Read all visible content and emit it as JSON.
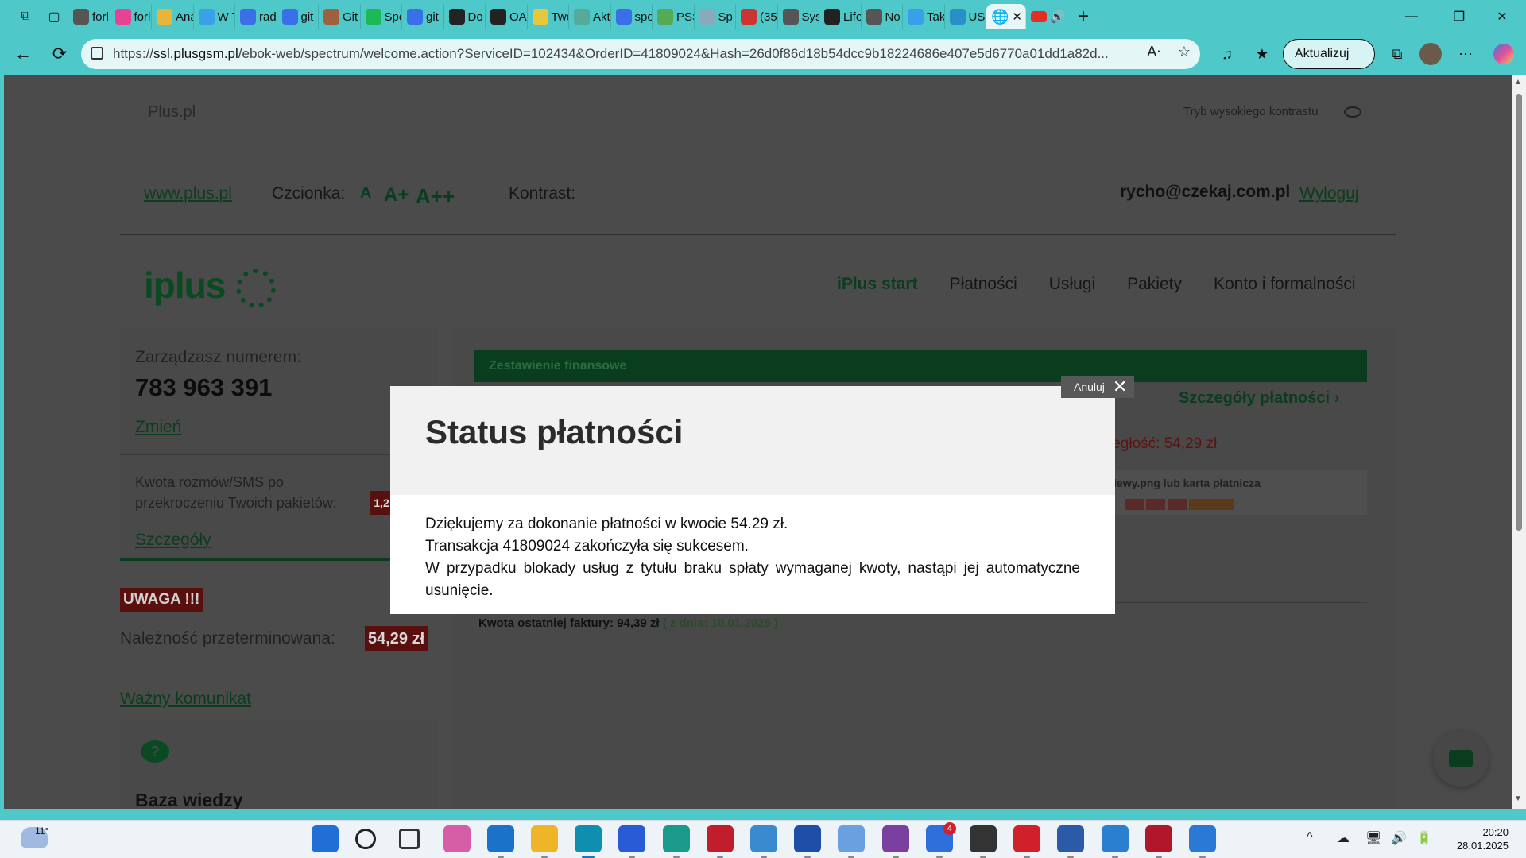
{
  "browser": {
    "tabs": [
      "forl",
      "forl",
      "Ana",
      "W T",
      "rad",
      "git",
      "Git",
      "Spo",
      "git",
      "Do",
      "OA",
      "Two",
      "Akt",
      "spo",
      "PSS",
      "Sp",
      "(35",
      "Sys",
      "Life",
      "No",
      "Tak",
      "US"
    ],
    "url_host": "ssl.plusgsm.pl",
    "url_path": "/ebok-web/spectrum/welcome.action?ServiceID=102434&OrderID=41809024&Hash=26d0f86d18b54dcc9b18224686e407e5d6770a01dd1a82d...",
    "url_scheme": "https://",
    "update_label": "Aktualizuj"
  },
  "page": {
    "header_logo": "Plus.pl",
    "high_contrast": "Tryb wysokiego kontrastu",
    "www_link": "www.plus.pl",
    "font_label": "Czcionka:",
    "font_sizes": [
      "A",
      "A+",
      "A++"
    ],
    "contrast_label": "Kontrast:",
    "user_email": "rycho@czekaj.com.pl",
    "logout": "Wyloguj",
    "brand": "iplus",
    "nav": [
      "iPlus start",
      "Płatności",
      "Usługi",
      "Pakiety",
      "Konto i formalności"
    ],
    "sidebar": {
      "managing_label": "Zarządzasz numerem:",
      "number": "783 963 391",
      "change": "Zmień",
      "quota_label": "Kwota rozmów/SMS po przekroczeniu Twoich pakietów:",
      "quota_badge": "1,2",
      "details": "Szczegóły"
    },
    "warning": "UWAGA !!!",
    "overdue_label": "Należność przeterminowana:",
    "overdue_value": "54,29 zł",
    "important_msg": "Ważny komunikat",
    "knowledge_base": "Baza wiedzy",
    "knowledge_icon": "?",
    "main": {
      "fin_title": "Zestawienie finansowe",
      "pay_details": "Szczegóły płatności",
      "debt": "ległość: 54,29 zł",
      "pay_methods": "lewy.png lub karta płatnicza",
      "last_invoice_label": "Kwota ostatniej faktury: 94,39 zł",
      "last_invoice_date": "( z dnia: 10.01.2025 )"
    }
  },
  "modal": {
    "title": "Status płatności",
    "cancel": "Anuluj",
    "lines": [
      "Dziękujemy za dokonanie płatności w kwocie 54.29 zł.",
      "Transakcja 41809024 zakończyła się sukcesem.",
      "W przypadku blokady usług z tytułu braku spłaty wymaganej kwoty, nastąpi jej automatyczne usunięcie."
    ]
  },
  "taskbar": {
    "weather_temp": "11°",
    "time": "20:20",
    "date": "28.01.2025",
    "notif_badge": "4"
  }
}
